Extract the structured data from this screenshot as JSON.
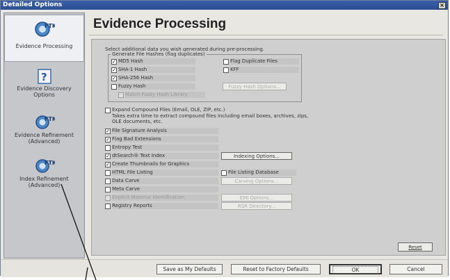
{
  "window": {
    "title": "Detailed Options",
    "close_glyph": "×"
  },
  "sidebar": {
    "items": [
      {
        "label_lines": [
          "Evidence Processing"
        ],
        "icon": "ftk-icon"
      },
      {
        "label_lines": [
          "Evidence Discovery",
          "Options"
        ],
        "icon": "help-question-icon"
      },
      {
        "label_lines": [
          "Evidence Refinement",
          "(Advanced)"
        ],
        "icon": "ftk-icon"
      },
      {
        "label_lines": [
          "Index Refinement",
          "(Advanced)"
        ],
        "icon": "ftk-icon"
      }
    ],
    "icon_text": "FTK"
  },
  "main": {
    "heading": "Evidence Processing",
    "intro": "Select additional data you wish generated during pre-processing.",
    "hash_group_title": "Generate File Hashes (flag duplicates)",
    "hash": {
      "md5": "MD5 Hash",
      "sha1": "SHA-1 Hash",
      "sha256": "SHA-256 Hash",
      "fuzzy": "Fuzzy Hash",
      "match_fuzzy": "Match Fuzzy Hash Library",
      "flag_dup": "Flag Duplicate Files",
      "kff": "KFF",
      "fuzzy_options": "Fuzzy Hash Options..."
    },
    "expand": {
      "label": "Expand Compound Files (Email, OLE, ZIP, etc.)",
      "desc1": "Takes extra time to extract compound files including email boxes, archives, zips,",
      "desc2": "OLE documents, etc."
    },
    "options": {
      "file_sig": "File Signature Analysis",
      "flag_bad": "Flag Bad Extensions",
      "entropy": "Entropy Test",
      "dtsearch": "dtSearch® Text Index",
      "thumbnails": "Create Thumbnails for Graphics",
      "html_listing": "HTML File Listing",
      "data_carve": "Data Carve",
      "meta_carve": "Meta Carve",
      "explicit": "Explicit Material Identification",
      "registry": "Registry Reports",
      "file_listing_db": "File Listing Database",
      "indexing_options": "Indexing Options...",
      "carving_options": "Carving Options...",
      "emi_options": "EMI Options...",
      "rsr_directory": "RSR Directory..."
    },
    "check_glyph": "✓",
    "reset": "Reset"
  },
  "footer": {
    "save_defaults": "Save as My Defaults",
    "reset_factory": "Reset to Factory Defaults",
    "ok": "OK",
    "cancel": "Cancel"
  }
}
